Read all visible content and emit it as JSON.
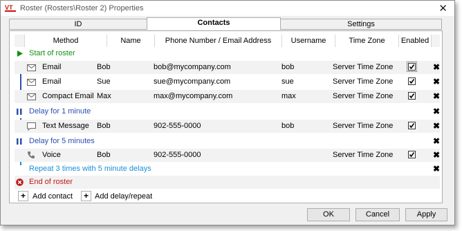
{
  "window": {
    "title": "Roster (Rosters\\Roster 2) Properties",
    "close_glyph": "✕",
    "logo_text": "VT"
  },
  "tabs": [
    {
      "label": "ID"
    },
    {
      "label": "Contacts"
    },
    {
      "label": "Settings"
    }
  ],
  "active_tab": "Contacts",
  "columns": {
    "method": "Method",
    "name": "Name",
    "address": "Phone Number / Email Address",
    "username": "Username",
    "timezone": "Time Zone",
    "enabled": "Enabled"
  },
  "roster": {
    "start_label": "Start of roster",
    "contacts": [
      {
        "method": "Email",
        "name": "Bob",
        "address": "bob@mycompany.com",
        "username": "bob",
        "timezone": "Server Time Zone",
        "enabled": true,
        "icon": "envelope-icon"
      },
      {
        "method": "Email",
        "name": "Sue",
        "address": "sue@mycompany.com",
        "username": "sue",
        "timezone": "Server Time Zone",
        "enabled": true,
        "icon": "envelope-icon"
      },
      {
        "method": "Compact Email",
        "name": "Max",
        "address": "max@mycompany.com",
        "username": "max",
        "timezone": "Server Time Zone",
        "enabled": true,
        "icon": "envelope-icon"
      }
    ],
    "delay1": "Delay for 1 minute",
    "text_contact": {
      "method": "Text Message",
      "name": "Bob",
      "address": "902-555-0000",
      "username": "bob",
      "timezone": "Server Time Zone",
      "enabled": true,
      "icon": "speech-bubble-icon"
    },
    "delay2": "Delay for 5 minutes",
    "voice_contact": {
      "method": "Voice",
      "name": "Bob",
      "address": "902-555-0000",
      "username": "",
      "timezone": "Server Time Zone",
      "enabled": true,
      "icon": "phone-icon"
    },
    "repeat_label": "Repeat 3 times with 5 minute delays",
    "end_label": "End of roster"
  },
  "actions": {
    "add_contact": "Add contact",
    "add_delay": "Add delay/repeat",
    "plus": "+"
  },
  "buttons": {
    "ok": "OK",
    "cancel": "Cancel",
    "apply": "Apply"
  },
  "delete_glyph": "✖",
  "colors": {
    "start": "#109010",
    "delay": "#2a4fb0",
    "repeat": "#1c8fd8",
    "end": "#c01818"
  }
}
